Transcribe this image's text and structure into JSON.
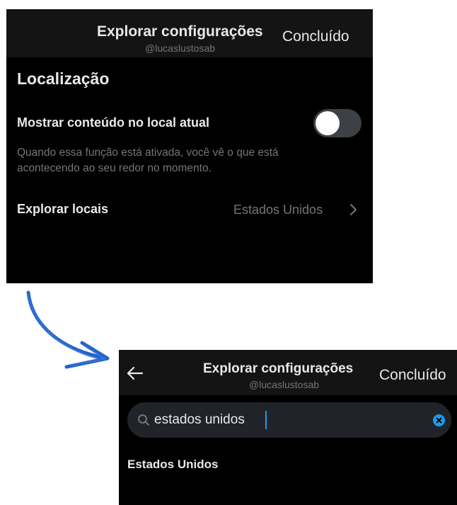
{
  "top_screen": {
    "header": {
      "title": "Explorar configurações",
      "handle": "@lucaslustosab",
      "done_label": "Concluído"
    },
    "section_title": "Localização",
    "show_local_content": {
      "label": "Mostrar conteúdo no local atual",
      "enabled": false,
      "description": "Quando essa função está ativada, você vê o que está acontecendo ao seu redor no momento."
    },
    "explore_locations": {
      "label": "Explorar locais",
      "value": "Estados Unidos"
    }
  },
  "bottom_screen": {
    "header": {
      "title": "Explorar configurações",
      "handle": "@lucaslustosab",
      "done_label": "Concluído"
    },
    "search": {
      "value": "estados unidos"
    },
    "results": [
      {
        "label": "Estados Unidos"
      }
    ]
  },
  "colors": {
    "background": "#000000",
    "header_bg": "#141414",
    "text_primary": "#e7e9ea",
    "text_secondary": "#71767b",
    "accent": "#1d9bf0",
    "arrow": "#2563c9"
  },
  "icons": {
    "arrow": "curved-arrow-icon",
    "chevron": "chevron-right-icon",
    "back": "back-arrow-icon",
    "search": "search-icon",
    "clear": "clear-icon"
  }
}
